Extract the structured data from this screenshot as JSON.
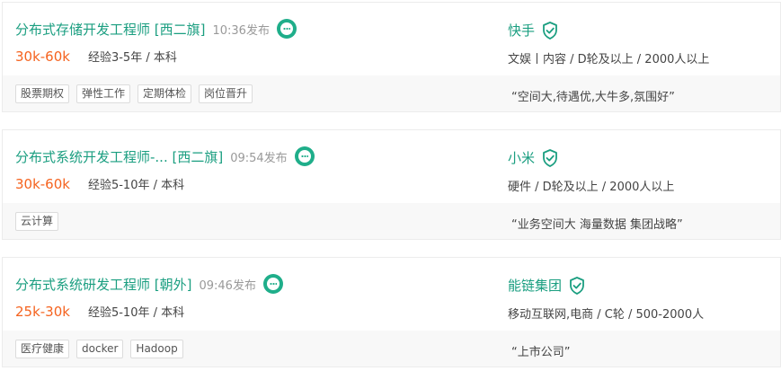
{
  "colors": {
    "accent": "#1a9e80",
    "salary": "#f5631f",
    "chat_badge": "#1fae8a"
  },
  "jobs": [
    {
      "title": "分布式存储开发工程师 [西二旗]",
      "time": "10:36发布",
      "salary": "30k-60k",
      "requirement": "经验3-5年 / 本科",
      "company": "快手",
      "company_info": "文娱丨内容 / D轮及以上 / 2000人以上",
      "tags": [
        "股票期权",
        "弹性工作",
        "定期体检",
        "岗位晋升"
      ],
      "slogan": "“空间大,待遇优,大牛多,氛围好”"
    },
    {
      "title": "分布式系统开发工程师-... [西二旗]",
      "time": "09:54发布",
      "salary": "30k-60k",
      "requirement": "经验5-10年 / 本科",
      "company": "小米",
      "company_info": "硬件 / D轮及以上 / 2000人以上",
      "tags": [
        "云计算"
      ],
      "slogan": "“业务空间大 海量数据 集团战略”"
    },
    {
      "title": "分布式系统研发工程师 [朝外]",
      "time": "09:46发布",
      "salary": "25k-30k",
      "requirement": "经验5-10年 / 本科",
      "company": "能链集团",
      "company_info": "移动互联网,电商 / C轮 / 500-2000人",
      "tags": [
        "医疗健康",
        "docker",
        "Hadoop"
      ],
      "slogan": "“上市公司”"
    }
  ]
}
